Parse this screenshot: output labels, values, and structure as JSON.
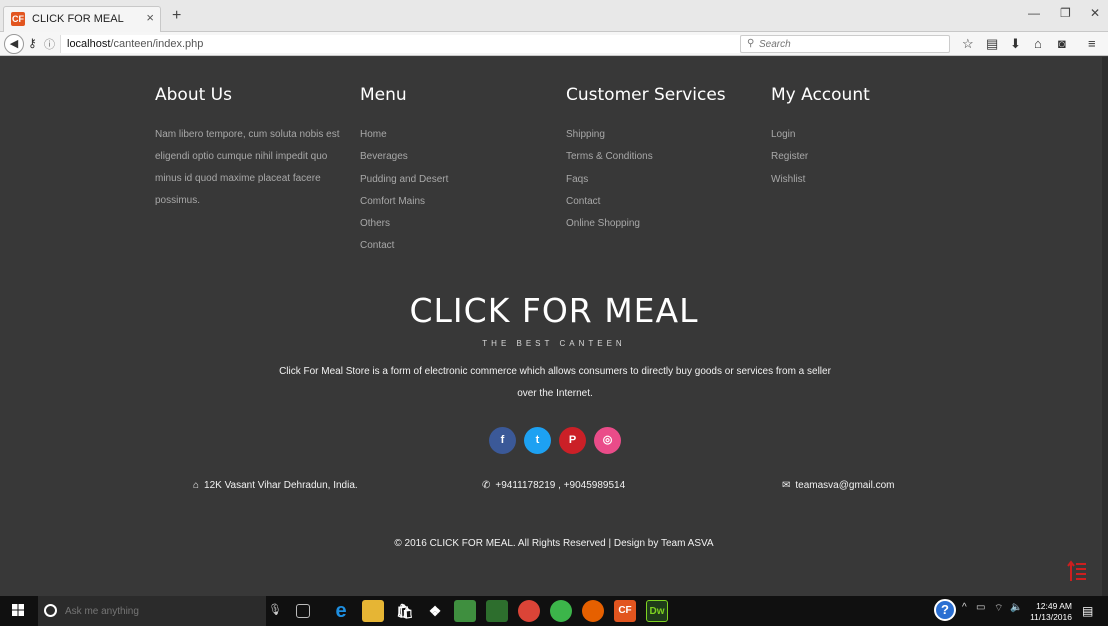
{
  "browser": {
    "tab_title": "CLICK FOR MEAL",
    "tab_favicon_text": "CF",
    "url_host": "localhost",
    "url_path": "/canteen/index.php",
    "search_placeholder": "Search"
  },
  "footer": {
    "columns": [
      {
        "heading": "About Us",
        "paragraph": "Nam libero tempore, cum soluta nobis est eligendi optio cumque nihil impedit quo minus id quod maxime placeat facere possimus."
      },
      {
        "heading": "Menu",
        "links": [
          "Home",
          "Beverages",
          "Pudding and Desert",
          "Comfort Mains",
          "Others",
          "Contact"
        ]
      },
      {
        "heading": "Customer Services",
        "links": [
          "Shipping",
          "Terms & Conditions",
          "Faqs",
          "Contact",
          "Online Shopping"
        ]
      },
      {
        "heading": "My Account",
        "links": [
          "Login",
          "Register",
          "Wishlist"
        ]
      }
    ],
    "brand": "CLICK FOR MEAL",
    "tagline": "THE BEST CANTEEN",
    "description": "Click For Meal Store is a form of electronic commerce which allows consumers to directly buy goods or services from a seller over the Internet.",
    "social": [
      {
        "name": "facebook-icon",
        "glyph": "f",
        "color": "#3b5998"
      },
      {
        "name": "twitter-icon",
        "glyph": "t",
        "color": "#1da1f2"
      },
      {
        "name": "pinterest-icon",
        "glyph": "P",
        "color": "#cb2027"
      },
      {
        "name": "dribbble-icon",
        "glyph": "◎",
        "color": "#ea4c89"
      }
    ],
    "contact": {
      "address": "12K Vasant Vihar Dehradun, India.",
      "phone": "+9411178219 , +9045989514",
      "email": "teamasva@gmail.com"
    },
    "copyright": "© 2016 CLICK FOR MEAL. All Rights Reserved | Design by Team ASVA"
  },
  "taskbar": {
    "search_placeholder": "Ask me anything",
    "time": "12:49 AM",
    "date": "11/13/2016",
    "dw_label": "Dw"
  },
  "colors": {
    "page_bg": "#383838",
    "link": "#a8a8a8",
    "accent_red": "#cc1f1f"
  }
}
